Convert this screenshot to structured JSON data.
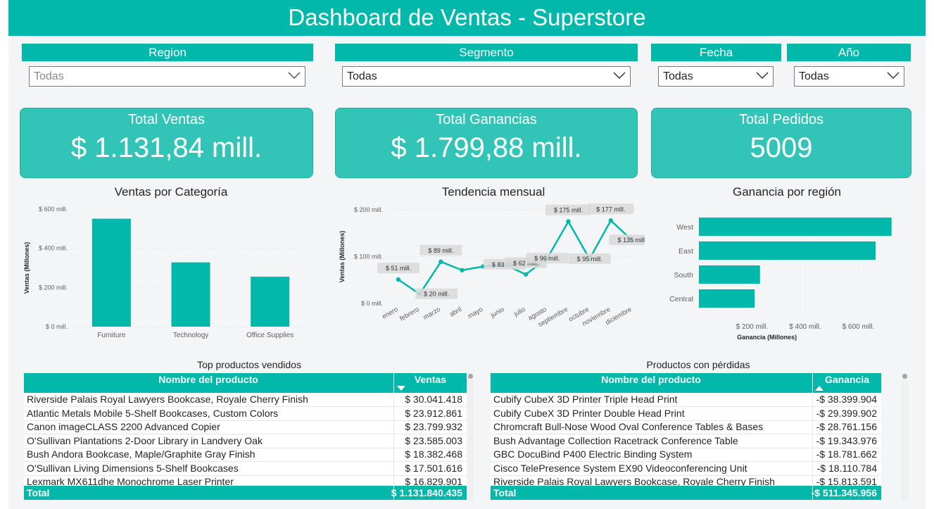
{
  "header": {
    "title": "Dashboard de Ventas - Superstore"
  },
  "filters": [
    {
      "title": "Region",
      "value": "Todas"
    },
    {
      "title": "Segmento",
      "value": "Todas"
    },
    {
      "title": "Fecha",
      "value": "Todas"
    },
    {
      "title": "Año",
      "value": "Todas"
    }
  ],
  "kpis": [
    {
      "title": "Total Ventas",
      "value": "$ 1.131,84 mill."
    },
    {
      "title": "Total Ganancias",
      "value": "$ 1.799,88 mill."
    },
    {
      "title": "Total Pedidos",
      "value": "5009"
    }
  ],
  "charts": {
    "categoria": {
      "title": "Ventas por Categoría"
    },
    "mensual": {
      "title": "Tendencia mensual"
    },
    "region": {
      "title": "Ganancia por región"
    }
  },
  "chart_data": [
    {
      "type": "bar",
      "title": "Ventas por Categoría",
      "ylabel": "Ventas (Millones)",
      "xlabel": "",
      "categories": [
        "Furniture",
        "Technology",
        "Office Supplies"
      ],
      "values": [
        551,
        328,
        255
      ],
      "ylim": [
        0,
        600
      ],
      "yticks": [
        "$ 0 mill.",
        "$ 200 mill.",
        "$ 400 mill.",
        "$ 600 mill."
      ],
      "colors": [
        "#01b8aa"
      ]
    },
    {
      "type": "line",
      "title": "Tendencia mensual",
      "ylabel": "Ventas (Millones)",
      "xlabel": "",
      "categories": [
        "enero",
        "febrero",
        "marzo",
        "abril",
        "mayo",
        "junio",
        "julio",
        "agosto",
        "septiembre",
        "octubre",
        "noviembre",
        "diciembre"
      ],
      "values": [
        51,
        20,
        89,
        71,
        79,
        83,
        62,
        96,
        175,
        95,
        177,
        135
      ],
      "data_labels": [
        "$ 51 mill.",
        "$ 20 mill.",
        "$ 89 mill.",
        "",
        "",
        "$ 83 mill.",
        "$ 62 mill.",
        "$ 96 mill.",
        "$ 175 mill.",
        "$ 95 mill.",
        "$ 177 mill.",
        "$ 135 mill."
      ],
      "ylim": [
        0,
        200
      ],
      "yticks": [
        "$ 0 mill.",
        "$ 100 mill.",
        "$ 200 mill."
      ],
      "colors": [
        "#01b8aa"
      ]
    },
    {
      "type": "bar",
      "orientation": "horizontal",
      "title": "Ganancia por región",
      "xlabel": "Ganancia (Millones)",
      "ylabel": "",
      "categories": [
        "West",
        "East",
        "South",
        "Central"
      ],
      "values": [
        725,
        665,
        230,
        210
      ],
      "xlim": [
        0,
        800
      ],
      "xticks": [
        "$ 200 mill.",
        "$ 400 mill.",
        "$ 600 mill."
      ],
      "colors": [
        "#01b8aa"
      ]
    }
  ],
  "top_products": {
    "title": "Top productos vendidos",
    "columns": [
      "Nombre del producto",
      "Ventas"
    ],
    "sort_icon": "sort-descending-icon",
    "rows": [
      [
        "Riverside Palais Royal Lawyers Bookcase, Royale Cherry Finish",
        "$ 30.041.418"
      ],
      [
        "Atlantic Metals Mobile 5-Shelf Bookcases, Custom Colors",
        "$ 23.912.861"
      ],
      [
        "Canon imageCLASS 2200 Advanced Copier",
        "$ 23.799.932"
      ],
      [
        "O'Sullivan Plantations 2-Door Library in Landvery Oak",
        "$ 23.585.003"
      ],
      [
        "Bush Andora Bookcase, Maple/Graphite Gray Finish",
        "$ 18.382.468"
      ],
      [
        "O'Sullivan Living Dimensions 5-Shelf Bookcases",
        "$ 17.501.616"
      ],
      [
        "Lexmark MX611dhe Monochrome Laser Printer",
        "$ 16.829.901"
      ]
    ],
    "total_label": "Total",
    "total_value": "$ 1.131.840.435"
  },
  "loss_products": {
    "title": "Productos con pérdidas",
    "columns": [
      "Nombre del producto",
      "Ganancia"
    ],
    "sort_icon": "sort-ascending-icon",
    "rows": [
      [
        "Cubify CubeX 3D Printer Triple Head Print",
        "-$ 38.399.904"
      ],
      [
        "Cubify CubeX 3D Printer Double Head Print",
        "-$ 29.399.902"
      ],
      [
        "Chromcraft Bull-Nose Wood Oval Conference Tables & Bases",
        "-$ 28.761.156"
      ],
      [
        "Bush Advantage Collection Racetrack Conference Table",
        "-$ 19.343.976"
      ],
      [
        "GBC DocuBind P400 Electric Binding System",
        "-$ 18.781.662"
      ],
      [
        "Cisco TelePresence System EX90 Videoconferencing Unit",
        "-$ 18.110.784"
      ],
      [
        "Riverside Palais Royal Lawyers Bookcase, Royale Cherry Finish",
        "-$ 15.813.591"
      ]
    ],
    "total_label": "Total",
    "total_value": "-$ 511.345.956"
  },
  "theme": {
    "accent": "#01b8aa",
    "card": "#33c4b8",
    "background": "#f4f5f7"
  }
}
